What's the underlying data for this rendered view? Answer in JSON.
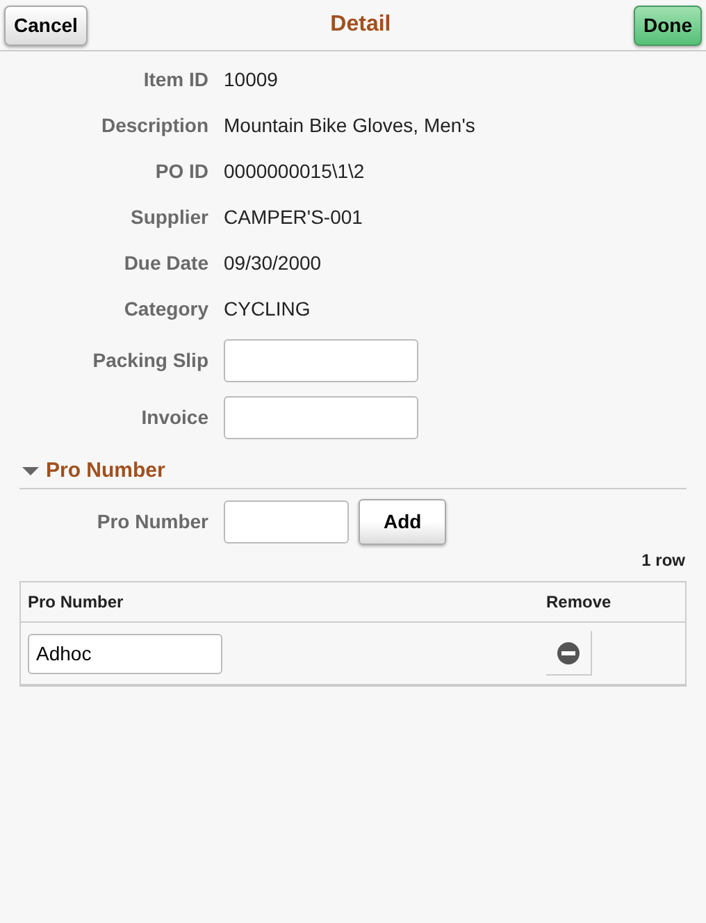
{
  "header": {
    "title": "Detail",
    "left_button": "Cancel",
    "right_button": "Done"
  },
  "fields": [
    {
      "label": "Item ID",
      "kind": "text",
      "value": "10009"
    },
    {
      "label": "Description",
      "kind": "text",
      "value": "Mountain Bike Gloves, Men's"
    },
    {
      "label": "PO ID",
      "kind": "text",
      "value": "0000000015\\1\\2"
    },
    {
      "label": "Supplier",
      "kind": "text",
      "value": "CAMPER'S-001"
    },
    {
      "label": "Due Date",
      "kind": "text",
      "value": "09/30/2000"
    },
    {
      "label": "Category",
      "kind": "text",
      "value": "CYCLING"
    },
    {
      "label": "Packing Slip",
      "kind": "input"
    },
    {
      "label": "Invoice",
      "kind": "input"
    }
  ],
  "section": {
    "title": "Pro Number",
    "expanded": true,
    "add_label": "Pro Number",
    "add_button": "Add",
    "row_count": "1 row",
    "table": {
      "columns": [
        "Pro Number",
        "Remove"
      ],
      "rows": [
        {
          "pro_number": "Adhoc"
        }
      ]
    }
  }
}
